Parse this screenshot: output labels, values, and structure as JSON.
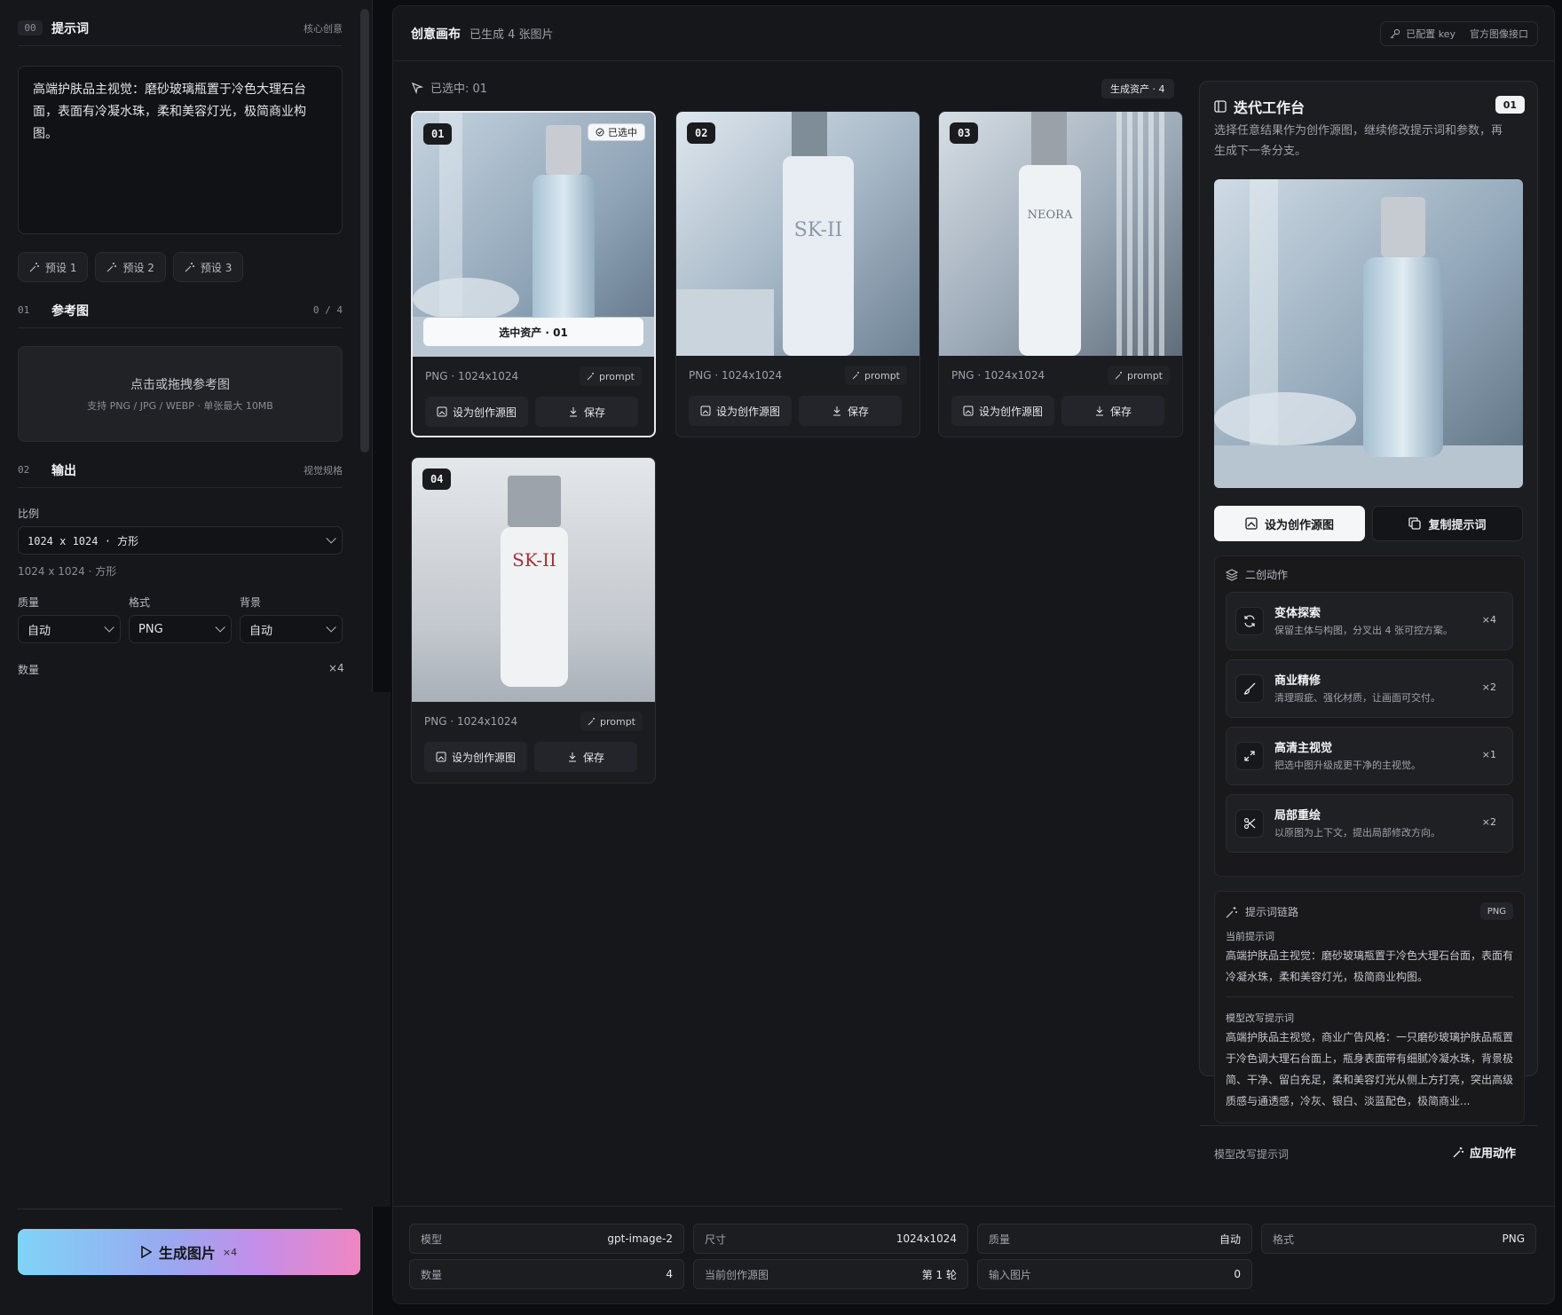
{
  "left": {
    "prompt_section": {
      "num": "00",
      "title": "提示词",
      "right": "核心创意"
    },
    "prompt_text": "高端护肤品主视觉：磨砂玻璃瓶置于冷色大理石台面，表面有冷凝水珠，柔和美容灯光，极简商业构图。",
    "presets": [
      "预设 1",
      "预设 2",
      "预设 3"
    ],
    "ref_section": {
      "num": "01",
      "title": "参考图",
      "right": "0 / 4"
    },
    "dropzone": {
      "title": "点击或拖拽参考图",
      "hint": "支持 PNG / JPG / WEBP · 单张最大 10MB"
    },
    "output_section": {
      "num": "02",
      "title": "输出",
      "right": "视觉规格"
    },
    "ratio_label": "比例",
    "ratio_value": "1024 x 1024 · 方形",
    "ratio_sub": "1024 x 1024 · 方形",
    "quality_label": "质量",
    "quality_value": "自动",
    "format_label": "格式",
    "format_value": "PNG",
    "bg_label": "背景",
    "bg_value": "自动",
    "count_label": "数量",
    "count_value": "×4",
    "generate_label": "生成图片",
    "generate_count": "×4"
  },
  "main": {
    "title": "创意画布",
    "subtitle": "已生成 4 张图片",
    "key_status": "已配置 key",
    "api_label": "官方图像接口",
    "selected_text": "已选中: 01",
    "asset_count": "生成资产 · 4",
    "cards": [
      {
        "badge": "01",
        "meta": "PNG · 1024x1024",
        "prompt": "prompt",
        "set_source": "设为创作源图",
        "save": "保存",
        "chosen": "已选中",
        "overlay": "选中资产 · 01"
      },
      {
        "badge": "02",
        "meta": "PNG · 1024x1024",
        "prompt": "prompt",
        "set_source": "设为创作源图",
        "save": "保存",
        "brand": "SK-II"
      },
      {
        "badge": "03",
        "meta": "PNG · 1024x1024",
        "prompt": "prompt",
        "set_source": "设为创作源图",
        "save": "保存",
        "brand": "NEORA"
      },
      {
        "badge": "04",
        "meta": "PNG · 1024x1024",
        "prompt": "prompt",
        "set_source": "设为创作源图",
        "save": "保存",
        "brand": "SK-II"
      }
    ]
  },
  "workbench": {
    "title": "迭代工作台",
    "num": "01",
    "desc": "选择任意结果作为创作源图，继续修改提示词和参数，再生成下一条分支。",
    "set_source": "设为创作源图",
    "copy_prompt": "复制提示词",
    "remix_title": "二创动作",
    "actions": [
      {
        "name": "变体探索",
        "desc": "保留主体与构图，分叉出 4 张可控方案。",
        "mult": "×4"
      },
      {
        "name": "商业精修",
        "desc": "清理瑕疵、强化材质，让画面可交付。",
        "mult": "×2"
      },
      {
        "name": "高清主视觉",
        "desc": "把选中图升级成更干净的主视觉。",
        "mult": "×1"
      },
      {
        "name": "局部重绘",
        "desc": "以原图为上下文，提出局部修改方向。",
        "mult": "×2"
      }
    ],
    "chain_title": "提示词链路",
    "chain_badge": "PNG",
    "current_label": "当前提示词",
    "current_text": "高端护肤品主视觉：磨砂玻璃瓶置于冷色大理石台面，表面有冷凝水珠，柔和美容灯光，极简商业构图。",
    "rewrite_label": "模型改写提示词",
    "rewrite_text": "高端护肤品主视觉，商业广告风格：一只磨砂玻璃护肤品瓶置于冷色调大理石台面上，瓶身表面带有细腻冷凝水珠，背景极简、干净、留白充足，柔和美容灯光从侧上方打亮，突出高级质感与通透感，冷灰、银白、淡蓝配色，极简商业...",
    "footer_label": "模型改写提示词",
    "apply_label": "应用动作"
  },
  "stats": [
    {
      "k": "模型",
      "v": "gpt-image-2"
    },
    {
      "k": "尺寸",
      "v": "1024x1024"
    },
    {
      "k": "质量",
      "v": "自动"
    },
    {
      "k": "格式",
      "v": "PNG"
    },
    {
      "k": "数量",
      "v": "4"
    },
    {
      "k": "当前创作源图",
      "v": "第 1 轮"
    },
    {
      "k": "输入图片",
      "v": "0"
    }
  ]
}
